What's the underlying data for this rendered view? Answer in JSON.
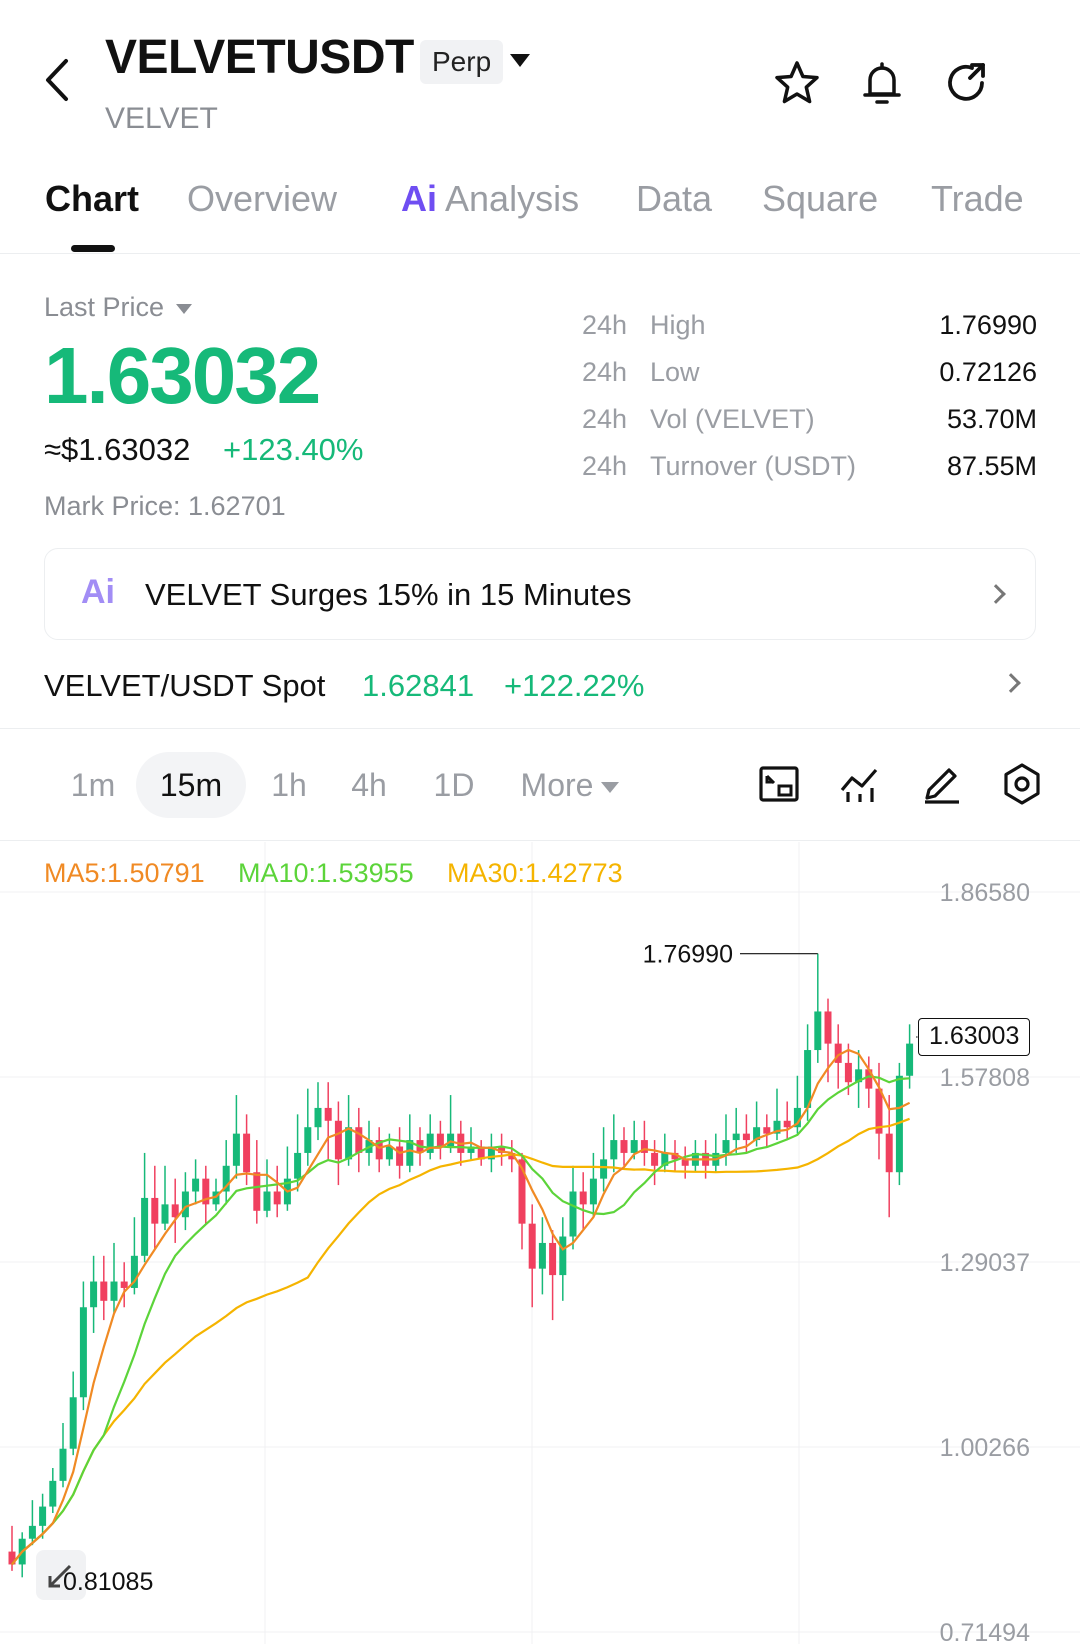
{
  "header": {
    "symbol": "VELVETUSDT",
    "contract_type": "Perp",
    "base_asset": "VELVET",
    "icons": [
      "back-arrow-icon",
      "star-icon",
      "bell-icon",
      "share-icon"
    ]
  },
  "tabs": [
    {
      "label": "Chart",
      "active": true
    },
    {
      "label": "Overview",
      "active": false
    },
    {
      "label": "Analysis",
      "prefix": "Ai",
      "active": false
    },
    {
      "label": "Data",
      "active": false
    },
    {
      "label": "Square",
      "active": false
    },
    {
      "label": "Trade",
      "active": false
    }
  ],
  "price": {
    "last_price_label": "Last Price",
    "last_price": "1.63032",
    "usd_value": "≈$1.63032",
    "change_pct": "+123.40%",
    "mark_price": "Mark Price: 1.62701"
  },
  "stats": [
    {
      "prefix": "24h",
      "label": "High",
      "value": "1.76990"
    },
    {
      "prefix": "24h",
      "label": "Low",
      "value": "0.72126"
    },
    {
      "prefix": "24h",
      "label": "Vol (VELVET)",
      "value": "53.70M"
    },
    {
      "prefix": "24h",
      "label": "Turnover (USDT)",
      "value": "87.55M"
    }
  ],
  "ai_banner": {
    "icon": "Ai",
    "text": "VELVET Surges 15% in 15 Minutes"
  },
  "spot": {
    "label": "VELVET/USDT Spot",
    "price": "1.62841",
    "change_pct": "+122.22%"
  },
  "intervals": [
    {
      "label": "1m",
      "active": false
    },
    {
      "label": "15m",
      "active": true
    },
    {
      "label": "1h",
      "active": false
    },
    {
      "label": "4h",
      "active": false
    },
    {
      "label": "1D",
      "active": false
    },
    {
      "label": "More",
      "active": false
    }
  ],
  "chart_tools": [
    "fullscreen-icon",
    "indicators-icon",
    "draw-icon",
    "settings-icon"
  ],
  "ma_legend": {
    "ma5": "MA5:1.50791",
    "ma10": "MA10:1.53955",
    "ma30": "MA30:1.42773"
  },
  "colors": {
    "up": "#16b979",
    "down": "#f0405f",
    "ma5": "#f08a24",
    "ma10": "#5cd43a",
    "ma30": "#f5b400"
  },
  "chart_data": {
    "type": "candlestick",
    "y_ticks": [
      "1.86580",
      "1.57808",
      "1.29037",
      "1.00266",
      "0.71494"
    ],
    "ylim": [
      0.71494,
      1.8658
    ],
    "high_annotation": "1.76990",
    "low_annotation": "0.81085",
    "current_price_tag": "1.63003",
    "candles": [
      [
        0.84,
        0.82,
        0.88,
        0.81
      ],
      [
        0.82,
        0.86,
        0.87,
        0.8
      ],
      [
        0.86,
        0.88,
        0.92,
        0.85
      ],
      [
        0.88,
        0.91,
        0.93,
        0.86
      ],
      [
        0.91,
        0.95,
        0.97,
        0.9
      ],
      [
        0.95,
        1.0,
        1.04,
        0.94
      ],
      [
        1.0,
        1.08,
        1.12,
        0.99
      ],
      [
        1.08,
        1.22,
        1.26,
        1.06
      ],
      [
        1.22,
        1.26,
        1.3,
        1.18
      ],
      [
        1.26,
        1.23,
        1.3,
        1.2
      ],
      [
        1.23,
        1.26,
        1.32,
        1.21
      ],
      [
        1.26,
        1.25,
        1.29,
        1.22
      ],
      [
        1.25,
        1.3,
        1.36,
        1.24
      ],
      [
        1.3,
        1.39,
        1.46,
        1.29
      ],
      [
        1.39,
        1.35,
        1.44,
        1.31
      ],
      [
        1.35,
        1.38,
        1.44,
        1.34
      ],
      [
        1.38,
        1.36,
        1.42,
        1.32
      ],
      [
        1.36,
        1.4,
        1.43,
        1.34
      ],
      [
        1.4,
        1.42,
        1.45,
        1.38
      ],
      [
        1.42,
        1.38,
        1.44,
        1.35
      ],
      [
        1.38,
        1.4,
        1.42,
        1.37
      ],
      [
        1.4,
        1.44,
        1.48,
        1.38
      ],
      [
        1.44,
        1.49,
        1.55,
        1.42
      ],
      [
        1.49,
        1.43,
        1.52,
        1.41
      ],
      [
        1.43,
        1.37,
        1.48,
        1.35
      ],
      [
        1.37,
        1.4,
        1.45,
        1.36
      ],
      [
        1.4,
        1.38,
        1.44,
        1.36
      ],
      [
        1.38,
        1.42,
        1.47,
        1.37
      ],
      [
        1.42,
        1.46,
        1.52,
        1.4
      ],
      [
        1.46,
        1.5,
        1.56,
        1.44
      ],
      [
        1.5,
        1.53,
        1.57,
        1.48
      ],
      [
        1.53,
        1.51,
        1.57,
        1.45
      ],
      [
        1.51,
        1.45,
        1.54,
        1.41
      ],
      [
        1.45,
        1.5,
        1.55,
        1.44
      ],
      [
        1.5,
        1.46,
        1.53,
        1.43
      ],
      [
        1.46,
        1.48,
        1.51,
        1.44
      ],
      [
        1.48,
        1.45,
        1.5,
        1.43
      ],
      [
        1.45,
        1.47,
        1.49,
        1.44
      ],
      [
        1.47,
        1.44,
        1.5,
        1.42
      ],
      [
        1.44,
        1.48,
        1.52,
        1.43
      ],
      [
        1.48,
        1.46,
        1.5,
        1.44
      ],
      [
        1.46,
        1.49,
        1.52,
        1.45
      ],
      [
        1.49,
        1.47,
        1.51,
        1.45
      ],
      [
        1.47,
        1.49,
        1.55,
        1.46
      ],
      [
        1.49,
        1.46,
        1.51,
        1.44
      ],
      [
        1.46,
        1.47,
        1.5,
        1.45
      ],
      [
        1.47,
        1.45,
        1.48,
        1.44
      ],
      [
        1.45,
        1.47,
        1.49,
        1.43
      ],
      [
        1.47,
        1.46,
        1.49,
        1.44
      ],
      [
        1.46,
        1.45,
        1.48,
        1.43
      ],
      [
        1.45,
        1.35,
        1.46,
        1.31
      ],
      [
        1.35,
        1.28,
        1.38,
        1.22
      ],
      [
        1.28,
        1.32,
        1.36,
        1.24
      ],
      [
        1.32,
        1.27,
        1.34,
        1.2
      ],
      [
        1.27,
        1.33,
        1.36,
        1.23
      ],
      [
        1.33,
        1.4,
        1.44,
        1.31
      ],
      [
        1.4,
        1.38,
        1.43,
        1.34
      ],
      [
        1.38,
        1.42,
        1.46,
        1.36
      ],
      [
        1.42,
        1.45,
        1.5,
        1.4
      ],
      [
        1.45,
        1.48,
        1.52,
        1.43
      ],
      [
        1.48,
        1.46,
        1.5,
        1.44
      ],
      [
        1.46,
        1.48,
        1.51,
        1.45
      ],
      [
        1.48,
        1.46,
        1.51,
        1.44
      ],
      [
        1.46,
        1.44,
        1.48,
        1.41
      ],
      [
        1.44,
        1.46,
        1.49,
        1.43
      ],
      [
        1.46,
        1.45,
        1.48,
        1.43
      ],
      [
        1.45,
        1.44,
        1.47,
        1.42
      ],
      [
        1.44,
        1.46,
        1.48,
        1.43
      ],
      [
        1.46,
        1.44,
        1.48,
        1.42
      ],
      [
        1.44,
        1.46,
        1.49,
        1.43
      ],
      [
        1.46,
        1.48,
        1.52,
        1.44
      ],
      [
        1.48,
        1.49,
        1.53,
        1.46
      ],
      [
        1.49,
        1.48,
        1.52,
        1.46
      ],
      [
        1.48,
        1.5,
        1.54,
        1.47
      ],
      [
        1.5,
        1.49,
        1.52,
        1.47
      ],
      [
        1.49,
        1.51,
        1.56,
        1.48
      ],
      [
        1.51,
        1.5,
        1.54,
        1.48
      ],
      [
        1.5,
        1.53,
        1.58,
        1.49
      ],
      [
        1.53,
        1.62,
        1.66,
        1.51
      ],
      [
        1.62,
        1.68,
        1.77,
        1.6
      ],
      [
        1.68,
        1.63,
        1.7,
        1.57
      ],
      [
        1.63,
        1.6,
        1.66,
        1.56
      ],
      [
        1.6,
        1.57,
        1.63,
        1.55
      ],
      [
        1.57,
        1.59,
        1.62,
        1.53
      ],
      [
        1.59,
        1.56,
        1.61,
        1.53
      ],
      [
        1.56,
        1.49,
        1.6,
        1.45
      ],
      [
        1.49,
        1.43,
        1.55,
        1.36
      ],
      [
        1.43,
        1.58,
        1.6,
        1.41
      ],
      [
        1.58,
        1.63,
        1.66,
        1.56
      ]
    ]
  }
}
